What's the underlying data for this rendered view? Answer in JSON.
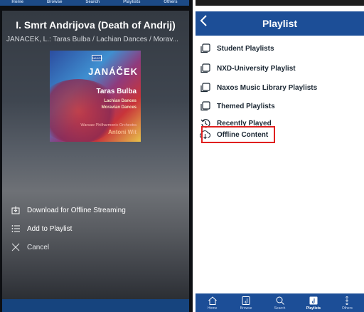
{
  "left_panel": {
    "top_nav": [
      "Home",
      "Browse",
      "Search",
      "Playlists",
      "Others"
    ],
    "track_title": "I. Smrt Andrijova (Death of Andrij)",
    "track_subtitle": "JANACEK, L.: Taras Bulba / Lachian Dances / Morav...",
    "cover": {
      "label": "NAXOS",
      "composer": "JANÁČEK",
      "work": "Taras Bulba",
      "subtitle_1": "Lachian Dances",
      "subtitle_2": "Moravian Dances",
      "orchestra": "Warsaw Philharmonic Orchestra",
      "conductor": "Antoni Wit"
    },
    "actions": [
      {
        "label": "Download for Offline Streaming",
        "icon": "download-icon"
      },
      {
        "label": "Add to Playlist",
        "icon": "list-add-icon"
      },
      {
        "label": "Cancel",
        "icon": "close-icon"
      }
    ]
  },
  "right_panel": {
    "title": "Playlist",
    "back_icon": "chevron-left-icon",
    "items": [
      {
        "label": "Student Playlists",
        "icon": "folder-stack-icon"
      },
      {
        "label": "NXD-University Playlist",
        "icon": "folder-stack-icon"
      },
      {
        "label": "Naxos Music Library Playlists",
        "icon": "folder-stack-icon"
      },
      {
        "label": "Themed Playlists",
        "icon": "folder-stack-icon"
      },
      {
        "label": "Recently Played",
        "icon": "history-icon"
      },
      {
        "label": "Offline Content",
        "icon": "cloud-download-icon",
        "highlighted": true
      }
    ],
    "bottom_tabs": [
      {
        "label": "Home",
        "icon": "home-icon"
      },
      {
        "label": "Browse",
        "icon": "browse-icon"
      },
      {
        "label": "Search",
        "icon": "search-icon"
      },
      {
        "label": "Playlists",
        "icon": "playlist-icon",
        "active": true
      },
      {
        "label": "Others",
        "icon": "more-icon"
      }
    ]
  },
  "colors": {
    "header_blue": "#1c4e97",
    "highlight_red": "#e0201f",
    "item_text": "#1b2733"
  }
}
